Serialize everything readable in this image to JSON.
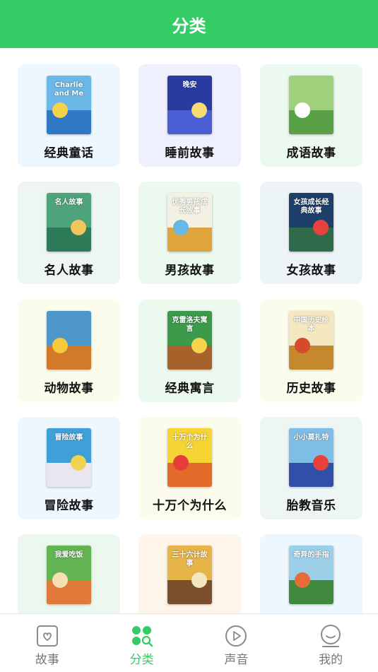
{
  "header": {
    "title": "分类"
  },
  "categories": [
    {
      "label": "经典童话",
      "bg": "#eef7fe",
      "cover_title": "Charlie and Me",
      "cover_bg": "#6ab8e8",
      "cover_accent": "#2e78c4",
      "cover_dot": "#f4d24a"
    },
    {
      "label": "睡前故事",
      "bg": "#eff0fd",
      "cover_title": "晚安",
      "cover_bg": "#2a3ba0",
      "cover_accent": "#4b5ed6",
      "cover_dot": "#f6dc72"
    },
    {
      "label": "成语故事",
      "bg": "#ecf9ee",
      "cover_title": "",
      "cover_bg": "#9fd07c",
      "cover_accent": "#5aa047",
      "cover_dot": "#ffffff"
    },
    {
      "label": "名人故事",
      "bg": "#edf6f3",
      "cover_title": "名人故事",
      "cover_bg": "#4fa37b",
      "cover_accent": "#2e7b5a",
      "cover_dot": "#f2c55a"
    },
    {
      "label": "男孩故事",
      "bg": "#ebf9ef",
      "cover_title": "优秀男孩成长故事",
      "cover_bg": "#f3f1e2",
      "cover_accent": "#e0a53a",
      "cover_dot": "#69b7e4"
    },
    {
      "label": "女孩故事",
      "bg": "#edf4f8",
      "cover_title": "女孩成长经典故事",
      "cover_bg": "#1e3f6a",
      "cover_accent": "#2f6a4a",
      "cover_dot": "#e8423f"
    },
    {
      "label": "动物故事",
      "bg": "#fbfcec",
      "cover_title": "",
      "cover_bg": "#4d98c9",
      "cover_accent": "#d27a2a",
      "cover_dot": "#f6c83c"
    },
    {
      "label": "经典寓言",
      "bg": "#ebf9ee",
      "cover_title": "克雷洛夫寓言",
      "cover_bg": "#3c9a4a",
      "cover_accent": "#a7622b",
      "cover_dot": "#f5d34c"
    },
    {
      "label": "历史故事",
      "bg": "#fbfcec",
      "cover_title": "中国历史绘本",
      "cover_bg": "#f5e7bf",
      "cover_accent": "#c6882d",
      "cover_dot": "#d64a2c"
    },
    {
      "label": "冒险故事",
      "bg": "#eef7fe",
      "cover_title": "冒险故事",
      "cover_bg": "#3fa0d8",
      "cover_accent": "#e9e6f0",
      "cover_dot": "#f1d34f"
    },
    {
      "label": "十万个为什么",
      "bg": "#fbfcec",
      "cover_title": "十万个为什么",
      "cover_bg": "#f6d433",
      "cover_accent": "#e46a2a",
      "cover_dot": "#e83c3c"
    },
    {
      "label": "胎教音乐",
      "bg": "#edf6f3",
      "cover_title": "小小莫扎特",
      "cover_bg": "#7ebde6",
      "cover_accent": "#2f4fa8",
      "cover_dot": "#e8413a"
    },
    {
      "label": "",
      "bg": "#ecf7ee",
      "cover_title": "我爱吃饭",
      "cover_bg": "#62b552",
      "cover_accent": "#e0793a",
      "cover_dot": "#f6e0b2"
    },
    {
      "label": "",
      "bg": "#fdf5ea",
      "cover_title": "三十六计故事",
      "cover_bg": "#e6b449",
      "cover_accent": "#7c4f2c",
      "cover_dot": "#f4e6c0"
    },
    {
      "label": "",
      "bg": "#eef7fe",
      "cover_title": "奇异的手指",
      "cover_bg": "#9bd0e8",
      "cover_accent": "#3f8a3c",
      "cover_dot": "#e86b3a"
    }
  ],
  "tabs": [
    {
      "label": "故事",
      "icon": "heart-box-icon",
      "active": false
    },
    {
      "label": "分类",
      "icon": "category-icon",
      "active": true
    },
    {
      "label": "声音",
      "icon": "play-circle-icon",
      "active": false
    },
    {
      "label": "我的",
      "icon": "smile-face-icon",
      "active": false
    }
  ],
  "colors": {
    "brand": "#35cc65",
    "inactive": "#777777"
  }
}
